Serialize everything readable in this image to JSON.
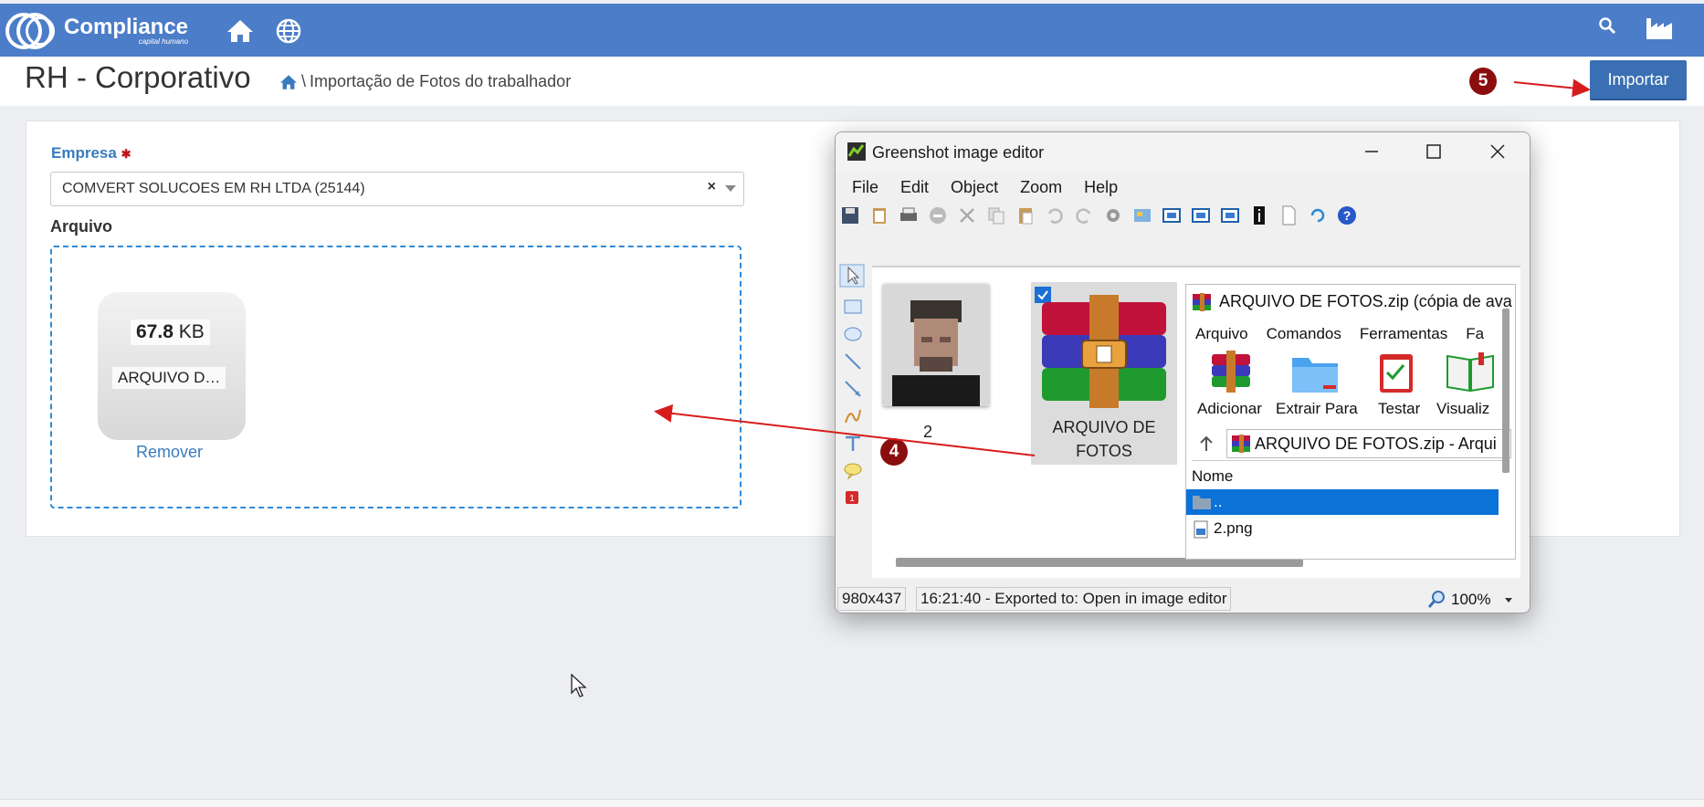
{
  "header": {
    "logo_text": "Compliance",
    "logo_sub": "capital humano",
    "icons": [
      "home-icon",
      "globe-icon",
      "search-icon",
      "factory-icon"
    ]
  },
  "page": {
    "title": "RH - Corporativo",
    "breadcrumb_sep": "\\",
    "breadcrumb_current": "Importação de Fotos do trabalhador",
    "import_button": "Importar",
    "step5": "5",
    "step4": "4"
  },
  "form": {
    "empresa_label": "Empresa",
    "empresa_required": "✱",
    "empresa_value": "COMVERT SOLUCOES EM RH LTDA (25144)",
    "clear_symbol": "×",
    "arquivo_label": "Arquivo",
    "file_size_num": "67.8",
    "file_size_unit": "KB",
    "file_name": "ARQUIVO D…",
    "remove_link": "Remover"
  },
  "greenshot": {
    "title": "Greenshot image editor",
    "menu": [
      "File",
      "Edit",
      "Object",
      "Zoom",
      "Help"
    ],
    "status_size": "980x437",
    "status_msg": "16:21:40 - Exported to: Open in image editor",
    "zoom": "100%",
    "thumb1_label": "2",
    "thumb2_label_1": "ARQUIVO DE",
    "thumb2_label_2": "FOTOS",
    "rar": {
      "title": "ARQUIVO DE FOTOS.zip (cópia de ava",
      "menu": [
        "Arquivo",
        "Comandos",
        "Ferramentas",
        "Fa"
      ],
      "buttons": [
        "Adicionar",
        "Extrair Para",
        "Testar",
        "Visualiz"
      ],
      "path": "ARQUIVO DE FOTOS.zip - Arqui",
      "col_name": "Nome",
      "row_up": "..",
      "row_file": "2.png"
    }
  },
  "colors": {
    "topbar": "#4c7dc8",
    "accent_blue": "#3a7bbf",
    "button_blue": "#3a6fb3",
    "badge_red": "#8b0e0e",
    "arrow_red": "#d81c1c"
  }
}
